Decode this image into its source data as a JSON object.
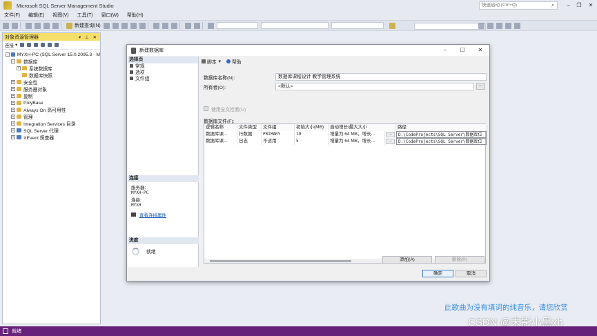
{
  "window": {
    "title": "Microsoft SQL Server Management Studio",
    "quick_launch_placeholder": "快速启动 (Ctrl+Q)"
  },
  "menu": [
    "文件(F)",
    "编辑(E)",
    "视图(V)",
    "工具(T)",
    "窗口(W)",
    "帮助(H)"
  ],
  "toolbar": {
    "new_query": "新建查询(N)"
  },
  "object_explorer": {
    "title": "对象资源管理器",
    "connect_label": "连接",
    "tree": [
      {
        "label": "MYXH-PC (SQL Server 15.0.2095.3 - M",
        "exp": "-",
        "icon": "server",
        "indent": 0
      },
      {
        "label": "数据库",
        "exp": "-",
        "icon": "folder",
        "indent": 1
      },
      {
        "label": "系统数据库",
        "exp": "+",
        "icon": "folder",
        "indent": 2
      },
      {
        "label": "数据库快照",
        "exp": "",
        "icon": "folder",
        "indent": 2
      },
      {
        "label": "安全性",
        "exp": "+",
        "icon": "folder",
        "indent": 1
      },
      {
        "label": "服务器对象",
        "exp": "+",
        "icon": "folder",
        "indent": 1
      },
      {
        "label": "复制",
        "exp": "+",
        "icon": "folder",
        "indent": 1
      },
      {
        "label": "PolyBase",
        "exp": "+",
        "icon": "folder",
        "indent": 1
      },
      {
        "label": "Always On 高可用性",
        "exp": "+",
        "icon": "folder",
        "indent": 1
      },
      {
        "label": "管理",
        "exp": "+",
        "icon": "folder",
        "indent": 1
      },
      {
        "label": "Integration Services 目录",
        "exp": "+",
        "icon": "folder",
        "indent": 1
      },
      {
        "label": "SQL Server 代理",
        "exp": "+",
        "icon": "server",
        "indent": 1
      },
      {
        "label": "XEvent 探查器",
        "exp": "+",
        "icon": "server",
        "indent": 1
      }
    ]
  },
  "dialog": {
    "title": "新建数据库",
    "select_page_header": "选择页",
    "pages": [
      "常规",
      "选项",
      "文件组"
    ],
    "connection_header": "连接",
    "server_label": "服务器:",
    "server_value": "MYXH-PC",
    "connection_label": "连接:",
    "connection_value": "MYXH",
    "view_connection_link": "查看连接属性",
    "progress_header": "进度",
    "progress_status": "就绪",
    "script_label": "脚本",
    "help_label": "帮助",
    "db_name_label": "数据库名称(N):",
    "db_name_value": "数据库课程设计 教学管理系统",
    "owner_label": "所有者(O):",
    "owner_value": "<默认>",
    "fulltext_label": "使用全文检索(U)",
    "files_label": "数据库文件(F):",
    "ellipsis": "...",
    "columns": [
      "逻辑名称",
      "文件类型",
      "文件组",
      "初始大小(MB)",
      "自动增长/最大大小",
      "路径"
    ],
    "rows": [
      [
        "数据库课...",
        "行数据",
        "PRIMARY",
        "10",
        "增量为 64 MB，增长...",
        "D:\\CodeProjects\\SQL Server\\数据库位"
      ],
      [
        "数据库课...",
        "日志",
        "不适用",
        "5",
        "增量为 64 MB，增长...",
        "D:\\CodeProjects\\SQL Server\\数据库位"
      ]
    ],
    "add_button": "添加(A)",
    "remove_button": "删除(R)",
    "ok_button": "确定",
    "cancel_button": "取消"
  },
  "status": {
    "text": "就绪"
  },
  "overlay": {
    "lyric": "此歌曲为没有填词的纯音乐，请您欣赏",
    "watermark": "CSDN @末影小黑xh"
  }
}
